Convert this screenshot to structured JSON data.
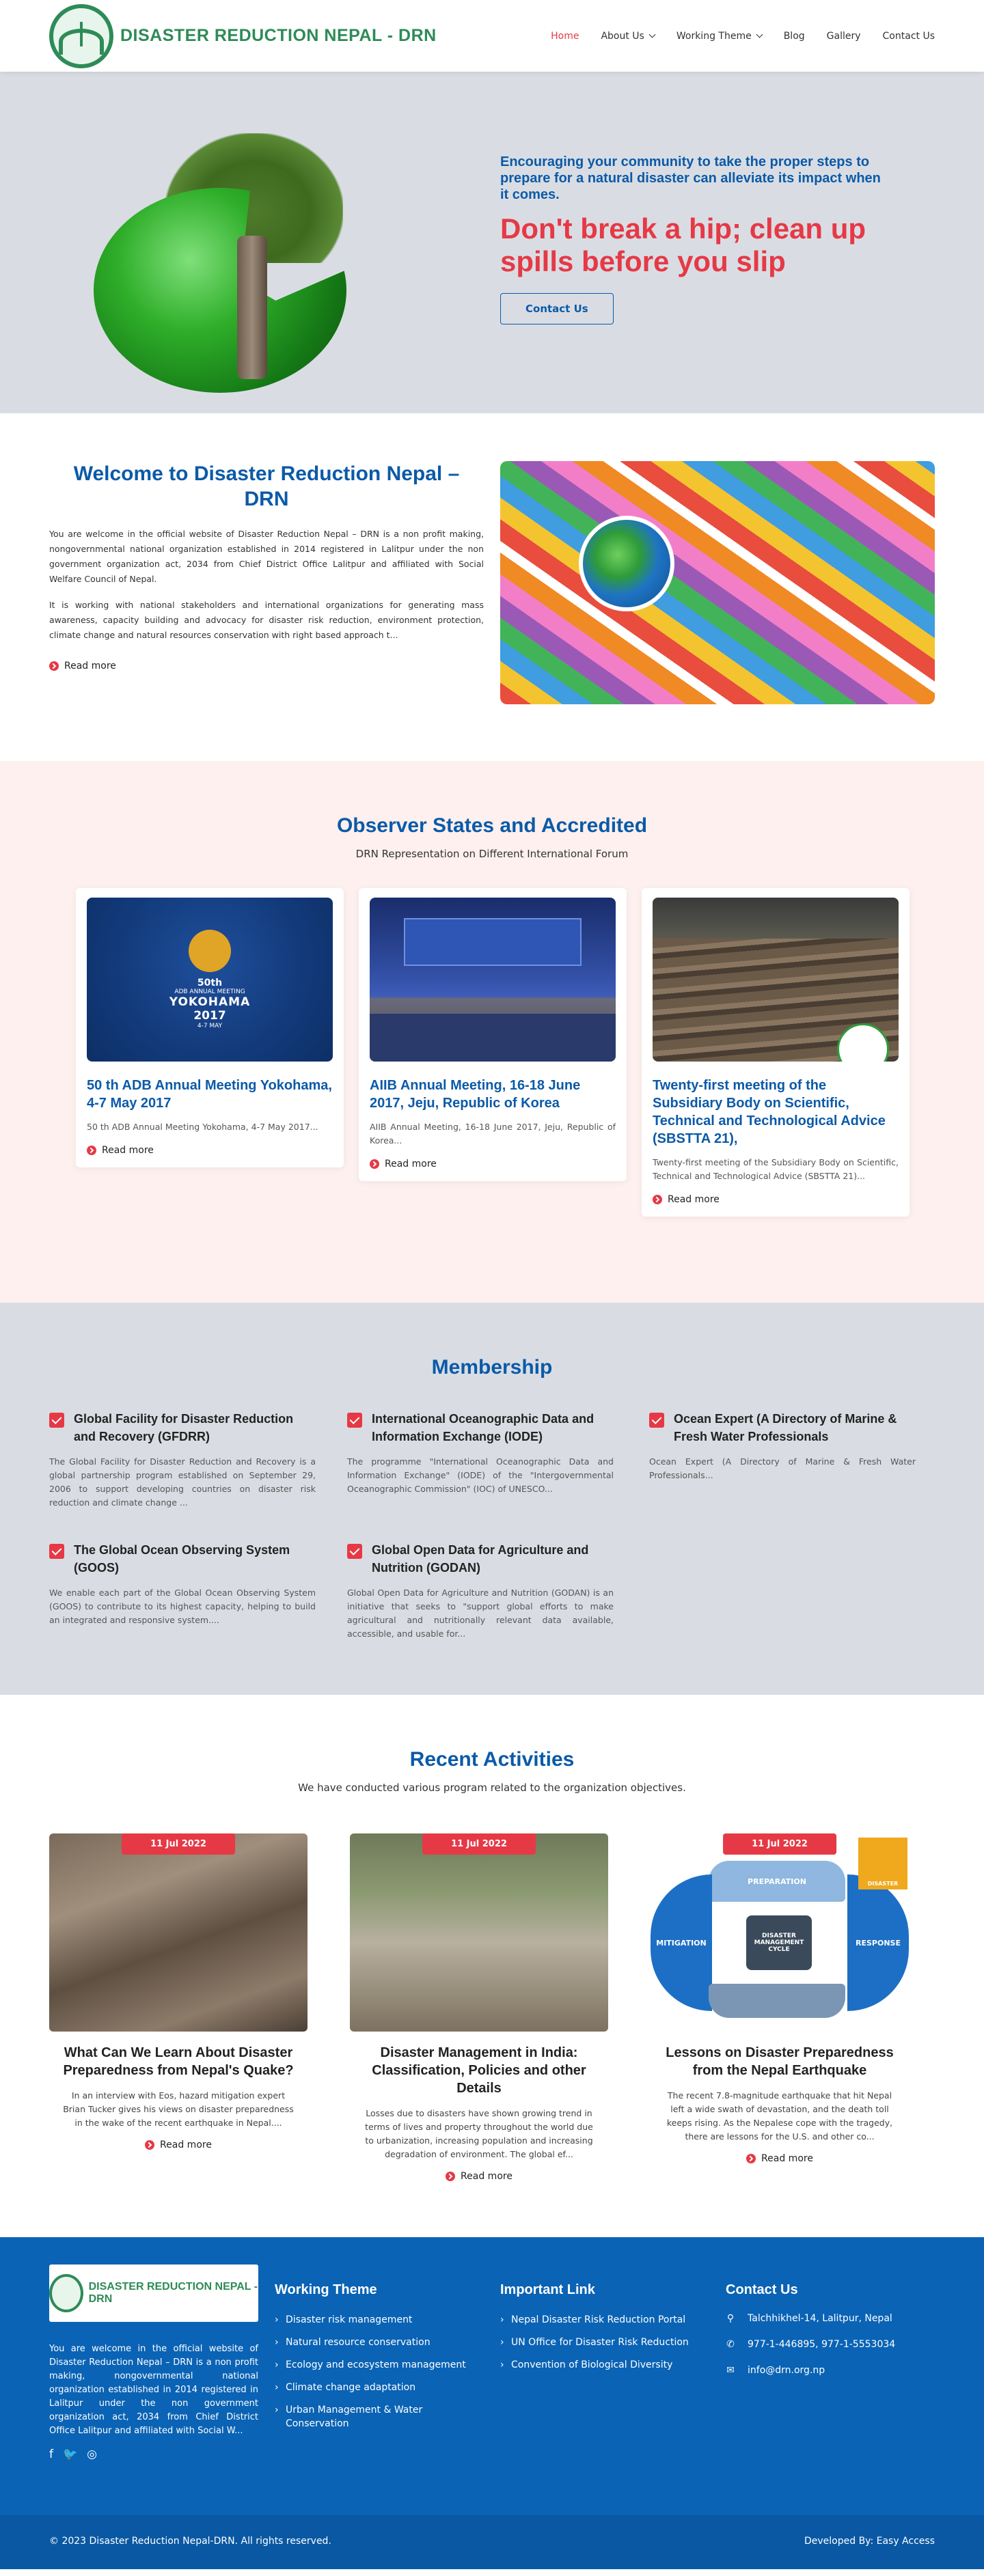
{
  "header": {
    "logo_text": "DISASTER REDUCTION NEPAL - DRN",
    "nav": [
      {
        "label": "Home",
        "active": true,
        "dropdown": false
      },
      {
        "label": "About Us",
        "active": false,
        "dropdown": true
      },
      {
        "label": "Working Theme",
        "active": false,
        "dropdown": true
      },
      {
        "label": "Blog",
        "active": false,
        "dropdown": false
      },
      {
        "label": "Gallery",
        "active": false,
        "dropdown": false
      },
      {
        "label": "Contact Us",
        "active": false,
        "dropdown": false
      }
    ]
  },
  "hero": {
    "subtitle": "Encouraging your community to take the proper steps to prepare for a natural disaster can alleviate its impact when it comes.",
    "title": "Don't break a hip; clean up spills before you slip",
    "button": "Contact Us"
  },
  "welcome": {
    "title": "Welcome to Disaster Reduction Nepal – DRN",
    "para1": "You are welcome in the official website of Disaster Reduction Nepal – DRN is a non profit making, nongovernmental national organization established in 2014 registered in Lalitpur under the non government organization act, 2034 from Chief District Office Lalitpur and affiliated with Social Welfare Council of Nepal.",
    "para2": "It is working with national stakeholders and international organizations for generating mass awareness, capacity building and advocacy for disaster risk reduction, environment protection, climate change and natural resources conservation with right based approach t...",
    "readmore": "Read more"
  },
  "observers": {
    "title": "Observer States and Accredited",
    "subtitle": "DRN Representation on Different International Forum",
    "cards": [
      {
        "title": "50 th ADB Annual Meeting Yokohama, 4-7 May 2017",
        "text": "50 th ADB Annual Meeting Yokohama, 4-7 May 2017...",
        "readmore": "Read more",
        "img_line1": "50th",
        "img_line2": "ADB ANNUAL MEETING",
        "img_line3": "YOKOHAMA",
        "img_line4": "2017",
        "img_line5": "4-7 MAY"
      },
      {
        "title": "AIIB Annual Meeting, 16-18 June 2017, Jeju, Republic of Korea",
        "text": "AIIB Annual Meeting, 16-18 June 2017, Jeju, Republic of Korea...",
        "readmore": "Read more"
      },
      {
        "title": "Twenty-first meeting of the Subsidiary Body on Scientific, Technical and Technological Advice (SBSTTA 21),",
        "text": "Twenty-first meeting of the Subsidiary Body on Scientific, Technical and Technological Advice (SBSTTA 21)...",
        "readmore": "Read more"
      }
    ]
  },
  "membership": {
    "title": "Membership",
    "items": [
      {
        "title": "Global Facility for Disaster Reduction and Recovery (GFDRR)",
        "text": "The Global Facility for Disaster Reduction and Recovery is a global partnership program established on September 29, 2006 to support developing countries on disaster risk reduction and climate change ..."
      },
      {
        "title": "International Oceanographic Data and Information Exchange (IODE)",
        "text": "The programme \"International Oceanographic Data and Information Exchange\" (IODE) of the \"Intergovernmental Oceanographic Commission\" (IOC) of UNESCO..."
      },
      {
        "title": "Ocean Expert (A Directory of Marine & Fresh Water Professionals",
        "text": "Ocean Expert (A Directory of Marine & Fresh Water Professionals..."
      },
      {
        "title": "The Global Ocean Observing System (GOOS)",
        "text": "We enable each part of the Global Ocean Observing System (GOOS) to contribute to its highest capacity, helping to build an integrated and responsive system...."
      },
      {
        "title": "Global Open Data for Agriculture and Nutrition (GODAN)",
        "text": "Global Open Data for Agriculture and Nutrition (GODAN) is an initiative that seeks to \"support global efforts to make agricultural and nutritionally relevant data available, accessible, and usable for..."
      }
    ]
  },
  "activities": {
    "title": "Recent Activities",
    "subtitle": "We have conducted various program related to the organization objectives.",
    "items": [
      {
        "date": "11 Jul 2022",
        "title": "What Can We Learn About Disaster Preparedness from Nepal's Quake?",
        "text": "In an interview with Eos, hazard mitigation expert Brian Tucker gives his views on disaster preparedness in the wake of the recent earthquake in Nepal....",
        "readmore": "Read more"
      },
      {
        "date": "11 Jul 2022",
        "title": "Disaster Management in India: Classification, Policies and other Details",
        "text": "Losses due to disasters have shown growing trend in terms of lives and property throughout the world due to urbanization, increasing population and increasing degradation of environment. The global ef...",
        "readmore": "Read more"
      },
      {
        "date": "11 Jul 2022",
        "title": "Lessons on Disaster Preparedness from the Nepal Earthquake",
        "text": "The recent 7.8-magnitude earthquake that hit Nepal left a wide swath of devastation, and the death toll keeps rising. As the Nepalese cope with the tragedy, there are lessons for the U.S. and other co...",
        "readmore": "Read more",
        "cycle": {
          "top": "PREPARATION",
          "left": "MITIGATION",
          "right": "RESPONSE",
          "center": "DISASTER MANAGEMENT CYCLE",
          "badge": "DISASTER"
        }
      }
    ]
  },
  "footer": {
    "logo_text": "DISASTER REDUCTION NEPAL - DRN",
    "about": "You are welcome in the official website of Disaster Reduction Nepal – DRN is a non profit making, nongovernmental national organization established in 2014 registered in Lalitpur under the non government organization act, 2034 from Chief District Office Lalitpur and affiliated with Social W...",
    "working_theme": {
      "title": "Working Theme",
      "items": [
        "Disaster risk management",
        "Natural resource conservation",
        "Ecology and ecosystem management",
        "Climate change adaptation",
        "Urban Management & Water Conservation"
      ]
    },
    "important_link": {
      "title": "Important Link",
      "items": [
        "Nepal Disaster Risk Reduction Portal",
        "UN Office for Disaster Risk Reduction",
        "Convention of Biological Diversity"
      ]
    },
    "contact": {
      "title": "Contact Us",
      "address": "Talchhikhel-14, Lalitpur, Nepal",
      "phone": "977-1-446895, 977-1-5553034",
      "email": "info@drn.org.np"
    },
    "copyright": "© 2023 Disaster Reduction Nepal-DRN. All rights reserved.",
    "developed_by": "Developed By: Easy Access"
  },
  "colors": {
    "brand_blue": "#0b5aa8",
    "accent_red": "#e63946",
    "logo_green": "#2e8b57",
    "footer_blue": "#0a63b5"
  }
}
